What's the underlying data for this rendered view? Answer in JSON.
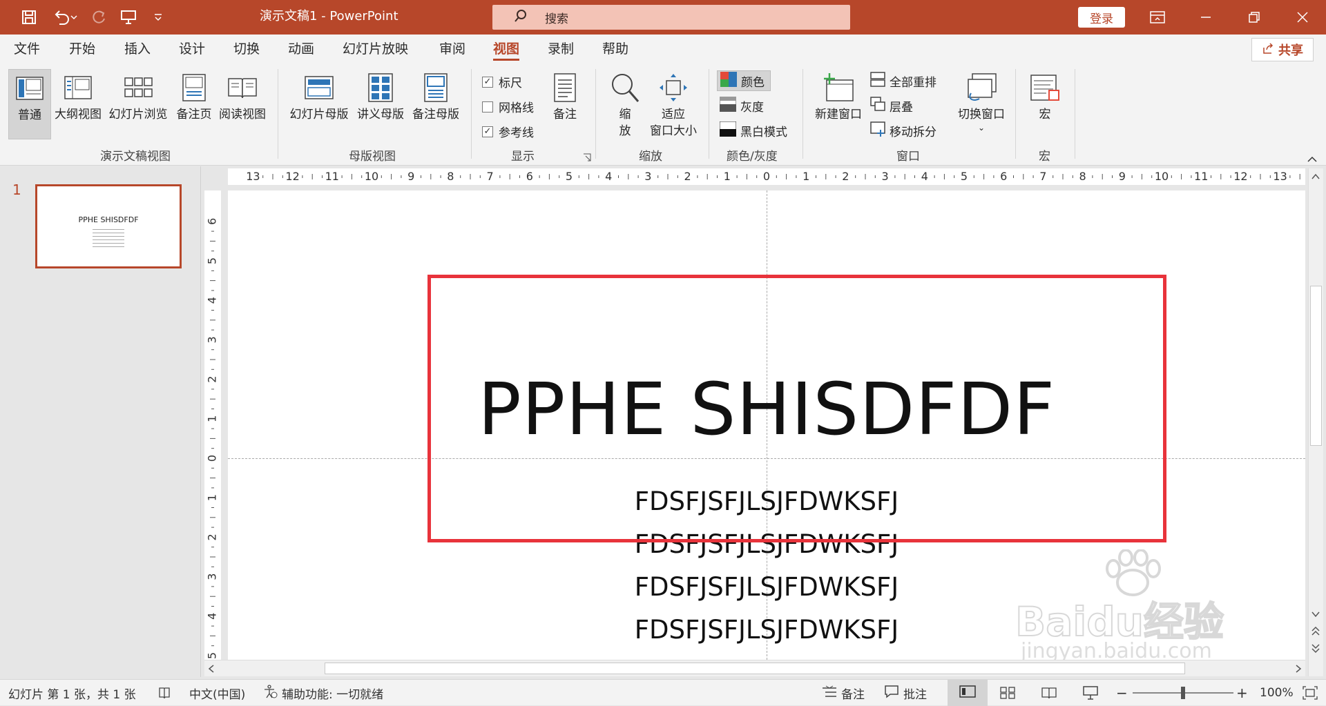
{
  "titlebar": {
    "doc_title": "演示文稿1  -  PowerPoint",
    "search_placeholder": "搜索",
    "login_label": "登录",
    "accent": "#b7472a"
  },
  "menu": {
    "file": "文件",
    "home": "开始",
    "insert": "插入",
    "design": "设计",
    "transitions": "切换",
    "animations": "动画",
    "slideshow": "幻灯片放映",
    "review": "审阅",
    "view": "视图",
    "record": "录制",
    "help": "帮助",
    "share": "共享"
  },
  "ribbon": {
    "normal": "普通",
    "outline": "大纲视图",
    "sorter": "幻灯片浏览",
    "notes_page": "备注页",
    "reading": "阅读视图",
    "group_views": "演示文稿视图",
    "slide_master": "幻灯片母版",
    "handout_master": "讲义母版",
    "notes_master": "备注母版",
    "group_master": "母版视图",
    "ruler": "标尺",
    "gridlines": "网格线",
    "guides": "参考线",
    "notes": "备注",
    "group_show": "显示",
    "zoom": "缩放",
    "zoom_line1": "缩",
    "zoom_line2": "放",
    "fit_line1": "适应",
    "fit_line2": "窗口大小",
    "group_zoom": "缩放",
    "color": "颜色",
    "grayscale": "灰度",
    "bw": "黑白模式",
    "group_color": "颜色/灰度",
    "new_window": "新建窗口",
    "arrange_all": "全部重排",
    "cascade": "层叠",
    "move_split": "移动拆分",
    "switch_windows": "切换窗口",
    "group_window": "窗口",
    "macros": "宏",
    "group_macros": "宏"
  },
  "thumbnail": {
    "number": "1",
    "title": "PPHE SHISDFDF"
  },
  "slide": {
    "title": "PPHE SHISDFDF",
    "lines": [
      "FDSFJSFJLSJFDWKSFJ",
      "FDSFJSFJLSJFDWKSFJ",
      "FDSFJSFJLSJFDWKSFJ",
      "FDSFJSFJLSJFDWKSFJ"
    ]
  },
  "ruler": {
    "h_labels": [
      "13",
      "12",
      "11",
      "10",
      "9",
      "8",
      "7",
      "6",
      "5",
      "4",
      "3",
      "2",
      "1",
      "0",
      "1",
      "2",
      "3",
      "4",
      "5",
      "6",
      "7",
      "8",
      "9",
      "10",
      "11",
      "12",
      "13"
    ],
    "v_labels": [
      "6",
      "5",
      "4",
      "3",
      "2",
      "1",
      "0",
      "1",
      "2",
      "3",
      "4",
      "5"
    ]
  },
  "status": {
    "slide_info": "幻灯片 第 1 张，共 1 张",
    "language": "中文(中国)",
    "accessibility": "辅助功能: 一切就绪",
    "notes": "备注",
    "comments": "批注",
    "zoom": "100%"
  },
  "watermark": {
    "brand": "Baidu经验",
    "url": "jingyan.baidu.com"
  },
  "colors": {
    "highlight_box": "#e8333b"
  }
}
